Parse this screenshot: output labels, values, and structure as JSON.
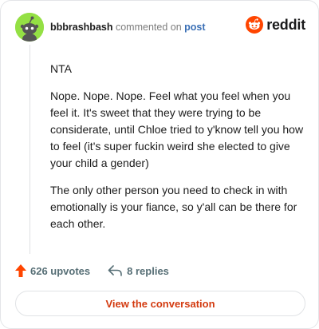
{
  "header": {
    "username": "bbbrashbash",
    "action_text": "commented on",
    "post_link": "post",
    "brand": "reddit",
    "brand_color": "#ff4500"
  },
  "comment": {
    "paragraphs": [
      "NTA",
      "Nope. Nope. Nope. Feel what you feel when you feel it. It's sweet that they were trying to be considerate, until Chloe tried to y'know tell you how to feel (it's super fuckin weird she elected to give your child a gender)",
      "The only other person you need to check in with emotionally is your fiance, so y'all can be there for each other."
    ]
  },
  "footer": {
    "upvotes": "626 upvotes",
    "replies": "8 replies",
    "upvote_icon": "arrow-up-icon",
    "reply_icon": "reply-arrow-icon",
    "accent_color": "#ff4500"
  },
  "cta": {
    "label": "View the conversation"
  }
}
